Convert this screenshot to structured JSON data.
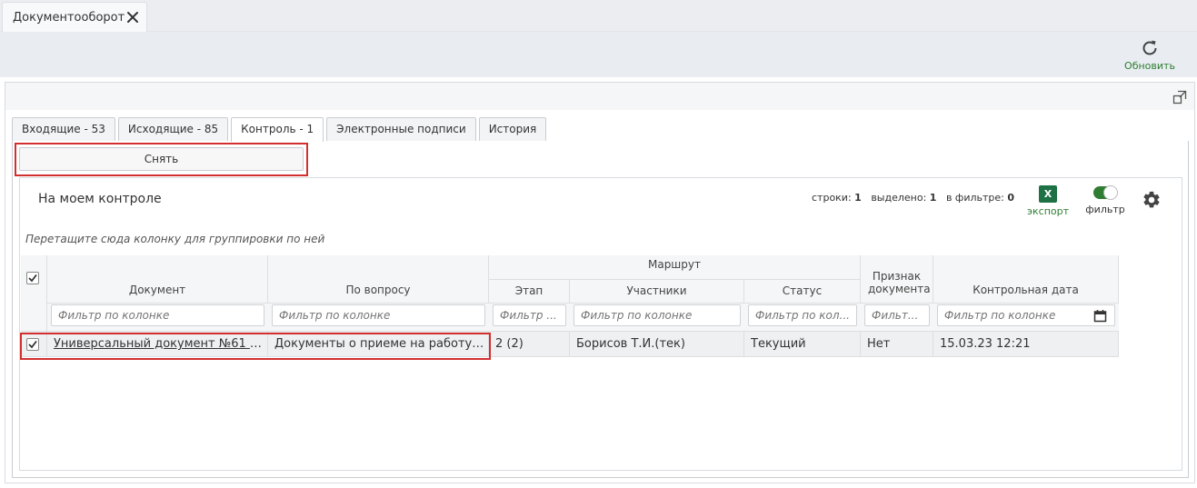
{
  "app_tab": {
    "label": "Документооборот"
  },
  "toolbar": {
    "refresh_label": "Обновить"
  },
  "tabs": [
    {
      "label": "Входящие - 53",
      "active": false
    },
    {
      "label": "Исходящие - 85",
      "active": false
    },
    {
      "label": "Контроль - 1",
      "active": true
    },
    {
      "label": "Электронные подписи",
      "active": false
    },
    {
      "label": "История",
      "active": false
    }
  ],
  "actions": {
    "remove_label": "Снять"
  },
  "grid": {
    "title": "На моем контроле",
    "stats": {
      "rows_label": "строки:",
      "rows_value": "1",
      "selected_label": "выделено:",
      "selected_value": "1",
      "filtered_label": "в фильтре:",
      "filtered_value": "0"
    },
    "export_label": "экспорт",
    "filter_label": "фильтр",
    "filter_enabled": true,
    "group_hint": "Перетащите сюда колонку для группировки по ней",
    "columns": {
      "document": "Документ",
      "question": "По вопросу",
      "route_group": "Маршрут",
      "stage": "Этап",
      "participants": "Участники",
      "status": "Статус",
      "doc_flag": "Признак документа",
      "control_date": "Контрольная дата"
    },
    "filter_placeholders": {
      "document": "Фильтр по колонке",
      "question": "Фильтр по колонке",
      "stage": "Фильтр ...",
      "participants": "Фильтр по колонке",
      "status": "Фильтр по кол...",
      "doc_flag": "Фильт...",
      "control_date": "Фильтр по колонке"
    },
    "rows": [
      {
        "checked": true,
        "document": "Универсальный документ №61 от ...",
        "question": "Документы о приеме на работу №...",
        "stage": "2 (2)",
        "participants": "Борисов Т.И.(тек)",
        "status": "Текущий",
        "doc_flag": "Нет",
        "control_date": "15.03.23 12:21"
      }
    ]
  },
  "colors": {
    "accent_green": "#2e7d32",
    "highlight_red": "#d32f2f",
    "link_purple": "#6a1b9a"
  }
}
